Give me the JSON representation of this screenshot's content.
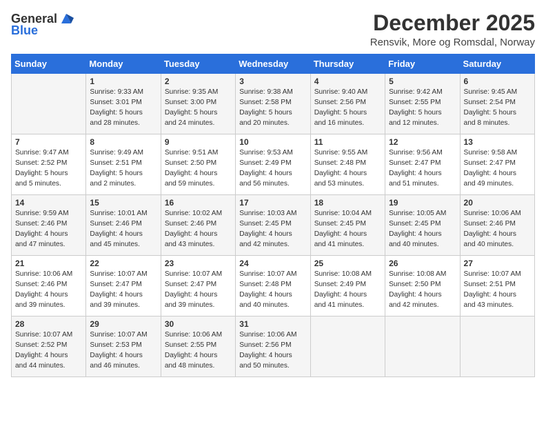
{
  "header": {
    "logo_general": "General",
    "logo_blue": "Blue",
    "title": "December 2025",
    "subtitle": "Rensvik, More og Romsdal, Norway"
  },
  "days_of_week": [
    "Sunday",
    "Monday",
    "Tuesday",
    "Wednesday",
    "Thursday",
    "Friday",
    "Saturday"
  ],
  "weeks": [
    [
      {
        "day": "",
        "info": ""
      },
      {
        "day": "1",
        "info": "Sunrise: 9:33 AM\nSunset: 3:01 PM\nDaylight: 5 hours\nand 28 minutes."
      },
      {
        "day": "2",
        "info": "Sunrise: 9:35 AM\nSunset: 3:00 PM\nDaylight: 5 hours\nand 24 minutes."
      },
      {
        "day": "3",
        "info": "Sunrise: 9:38 AM\nSunset: 2:58 PM\nDaylight: 5 hours\nand 20 minutes."
      },
      {
        "day": "4",
        "info": "Sunrise: 9:40 AM\nSunset: 2:56 PM\nDaylight: 5 hours\nand 16 minutes."
      },
      {
        "day": "5",
        "info": "Sunrise: 9:42 AM\nSunset: 2:55 PM\nDaylight: 5 hours\nand 12 minutes."
      },
      {
        "day": "6",
        "info": "Sunrise: 9:45 AM\nSunset: 2:54 PM\nDaylight: 5 hours\nand 8 minutes."
      }
    ],
    [
      {
        "day": "7",
        "info": "Sunrise: 9:47 AM\nSunset: 2:52 PM\nDaylight: 5 hours\nand 5 minutes."
      },
      {
        "day": "8",
        "info": "Sunrise: 9:49 AM\nSunset: 2:51 PM\nDaylight: 5 hours\nand 2 minutes."
      },
      {
        "day": "9",
        "info": "Sunrise: 9:51 AM\nSunset: 2:50 PM\nDaylight: 4 hours\nand 59 minutes."
      },
      {
        "day": "10",
        "info": "Sunrise: 9:53 AM\nSunset: 2:49 PM\nDaylight: 4 hours\nand 56 minutes."
      },
      {
        "day": "11",
        "info": "Sunrise: 9:55 AM\nSunset: 2:48 PM\nDaylight: 4 hours\nand 53 minutes."
      },
      {
        "day": "12",
        "info": "Sunrise: 9:56 AM\nSunset: 2:47 PM\nDaylight: 4 hours\nand 51 minutes."
      },
      {
        "day": "13",
        "info": "Sunrise: 9:58 AM\nSunset: 2:47 PM\nDaylight: 4 hours\nand 49 minutes."
      }
    ],
    [
      {
        "day": "14",
        "info": "Sunrise: 9:59 AM\nSunset: 2:46 PM\nDaylight: 4 hours\nand 47 minutes."
      },
      {
        "day": "15",
        "info": "Sunrise: 10:01 AM\nSunset: 2:46 PM\nDaylight: 4 hours\nand 45 minutes."
      },
      {
        "day": "16",
        "info": "Sunrise: 10:02 AM\nSunset: 2:46 PM\nDaylight: 4 hours\nand 43 minutes."
      },
      {
        "day": "17",
        "info": "Sunrise: 10:03 AM\nSunset: 2:45 PM\nDaylight: 4 hours\nand 42 minutes."
      },
      {
        "day": "18",
        "info": "Sunrise: 10:04 AM\nSunset: 2:45 PM\nDaylight: 4 hours\nand 41 minutes."
      },
      {
        "day": "19",
        "info": "Sunrise: 10:05 AM\nSunset: 2:45 PM\nDaylight: 4 hours\nand 40 minutes."
      },
      {
        "day": "20",
        "info": "Sunrise: 10:06 AM\nSunset: 2:46 PM\nDaylight: 4 hours\nand 40 minutes."
      }
    ],
    [
      {
        "day": "21",
        "info": "Sunrise: 10:06 AM\nSunset: 2:46 PM\nDaylight: 4 hours\nand 39 minutes."
      },
      {
        "day": "22",
        "info": "Sunrise: 10:07 AM\nSunset: 2:47 PM\nDaylight: 4 hours\nand 39 minutes."
      },
      {
        "day": "23",
        "info": "Sunrise: 10:07 AM\nSunset: 2:47 PM\nDaylight: 4 hours\nand 39 minutes."
      },
      {
        "day": "24",
        "info": "Sunrise: 10:07 AM\nSunset: 2:48 PM\nDaylight: 4 hours\nand 40 minutes."
      },
      {
        "day": "25",
        "info": "Sunrise: 10:08 AM\nSunset: 2:49 PM\nDaylight: 4 hours\nand 41 minutes."
      },
      {
        "day": "26",
        "info": "Sunrise: 10:08 AM\nSunset: 2:50 PM\nDaylight: 4 hours\nand 42 minutes."
      },
      {
        "day": "27",
        "info": "Sunrise: 10:07 AM\nSunset: 2:51 PM\nDaylight: 4 hours\nand 43 minutes."
      }
    ],
    [
      {
        "day": "28",
        "info": "Sunrise: 10:07 AM\nSunset: 2:52 PM\nDaylight: 4 hours\nand 44 minutes."
      },
      {
        "day": "29",
        "info": "Sunrise: 10:07 AM\nSunset: 2:53 PM\nDaylight: 4 hours\nand 46 minutes."
      },
      {
        "day": "30",
        "info": "Sunrise: 10:06 AM\nSunset: 2:55 PM\nDaylight: 4 hours\nand 48 minutes."
      },
      {
        "day": "31",
        "info": "Sunrise: 10:06 AM\nSunset: 2:56 PM\nDaylight: 4 hours\nand 50 minutes."
      },
      {
        "day": "",
        "info": ""
      },
      {
        "day": "",
        "info": ""
      },
      {
        "day": "",
        "info": ""
      }
    ]
  ]
}
